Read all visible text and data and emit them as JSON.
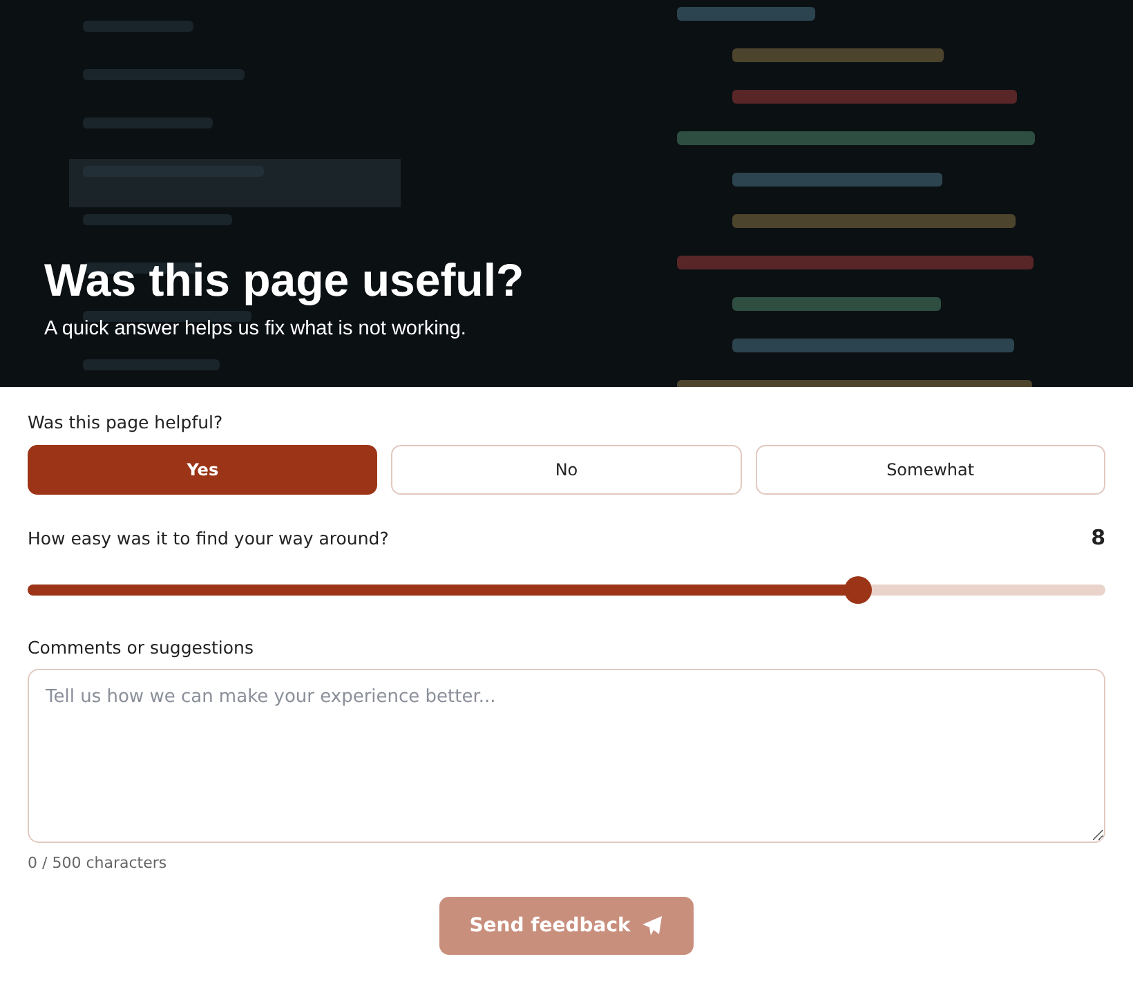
{
  "hero": {
    "title": "Was this page useful?",
    "subtitle": "A quick answer helps us fix what is not working."
  },
  "helpful": {
    "label": "Was this page helpful?",
    "options": [
      {
        "label": "Yes",
        "selected": true
      },
      {
        "label": "No",
        "selected": false
      },
      {
        "label": "Somewhat",
        "selected": false
      }
    ]
  },
  "ease": {
    "label": "How easy was it to find your way around?",
    "reading": "8",
    "level": 0.77
  },
  "comments": {
    "label": "Comments or suggestions",
    "placeholder": "Tell us how we can make your experience better...",
    "counter": "0 / 500 characters"
  },
  "submit": {
    "label": "Send feedback",
    "disabled": true
  }
}
